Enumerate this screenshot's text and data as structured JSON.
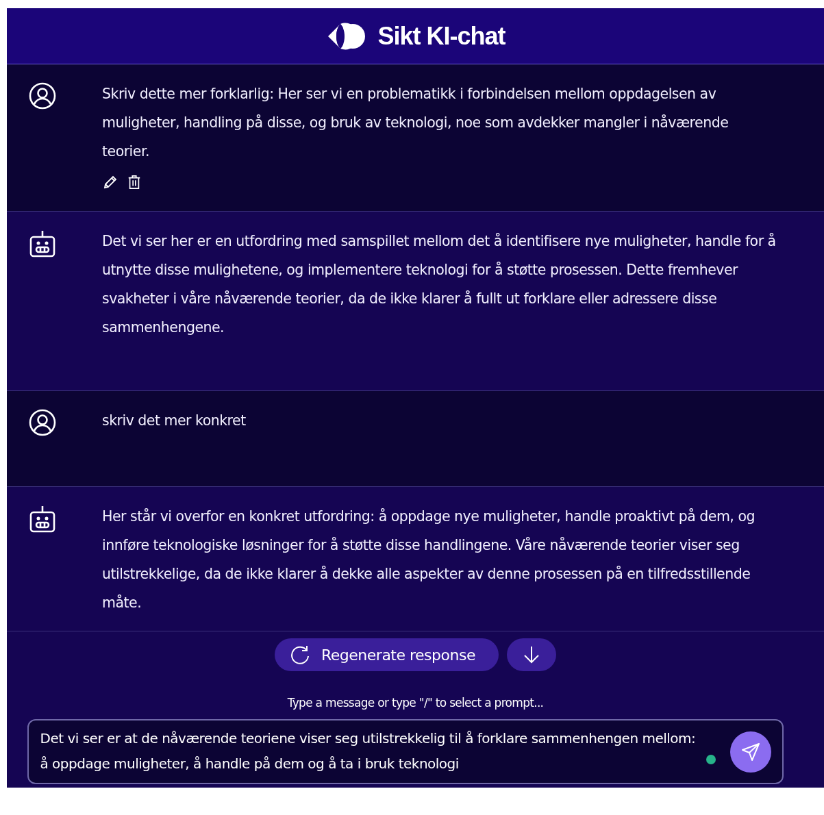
{
  "header": {
    "title": "Sikt KI-chat"
  },
  "messages": [
    {
      "kind": "user",
      "text": "Skriv dette mer forklarlig: Her ser vi en problematikk i forbindelsen mellom oppdagelsen av muligheter, handling på disse, og bruk av teknologi, noe som avdekker mangler i nåværende teorier.",
      "actions": true
    },
    {
      "kind": "bot",
      "text": "Det vi ser her er en utfordring med samspillet mellom det å identifisere nye muligheter, handle for å utnytte disse mulighetene, og implementere teknologi for å støtte prosessen. Dette fremhever svakheter i våre nåværende teorier, da de ikke klarer å fullt ut forklare eller adressere disse sammenhengene.",
      "actions": false
    },
    {
      "kind": "user",
      "text": "skriv det mer konkret",
      "actions": false
    },
    {
      "kind": "bot",
      "text": "Her står vi overfor en konkret utfordring: å oppdage nye muligheter, handle proaktivt på dem, og innføre teknologiske løsninger for å støtte disse handlingene. Våre nåværende teorier viser seg utilstrekkelige, da de ikke klarer å dekke alle aspekter av denne prosessen på en tilfredsstillende måte.",
      "actions": false
    }
  ],
  "regenerate_button": "Regenerate response",
  "hint": "Type a message or type \"/\" to select a prompt...",
  "input": {
    "value": "Det vi ser er at de nåværende teoriene viser seg utilstrekkelig til å forklare sammenhengen mellom: å oppdage muligheter, å handle på dem og å ta i bruk teknologi"
  }
}
